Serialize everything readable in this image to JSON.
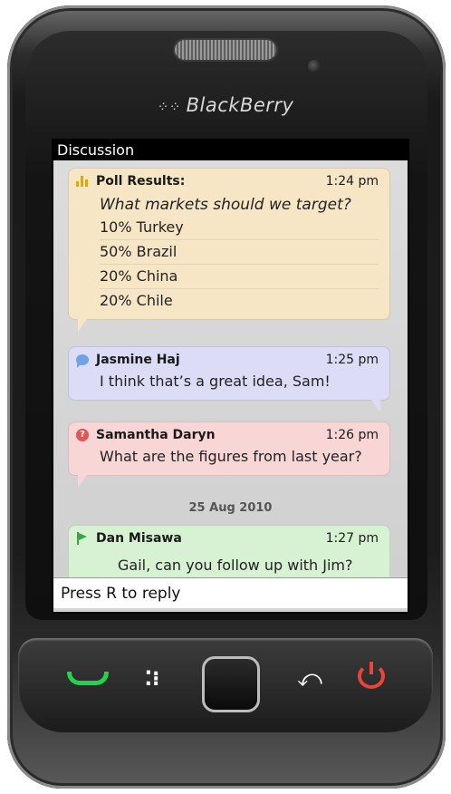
{
  "device": {
    "brand": "BlackBerry"
  },
  "screen": {
    "title": "Discussion",
    "poll": {
      "header": "Poll Results:",
      "time": "1:24 pm",
      "question": "What markets should we target?",
      "options": [
        "10% Turkey",
        "50% Brazil",
        "20% China",
        "20% Chile"
      ]
    },
    "messages": [
      {
        "name": "Jasmine Haj",
        "time": "1:25 pm",
        "text": "I think that’s a great idea, Sam!",
        "icon": "chat-icon"
      },
      {
        "name": "Samantha Daryn",
        "time": "1:26 pm",
        "text": "What are the figures from last year?",
        "icon": "question-icon"
      },
      {
        "name": "Dan Misawa",
        "time": "1:27 pm",
        "text": "Gail, can you follow up with Jim?",
        "icon": "flag-icon"
      }
    ],
    "date_separator": "25 Aug 2010",
    "reply_prompt": "Press R to reply"
  },
  "keys": {
    "menu_glyph": "⁚⁝",
    "back_glyph": "⤺"
  },
  "colors": {
    "poll_bg": "#f6e6c6",
    "msg1_bg": "#dcdcf6",
    "msg2_bg": "#f8d6d6",
    "msg3_bg": "#d6f2d2",
    "call_key": "#22d44c",
    "end_key": "#e8453c"
  }
}
